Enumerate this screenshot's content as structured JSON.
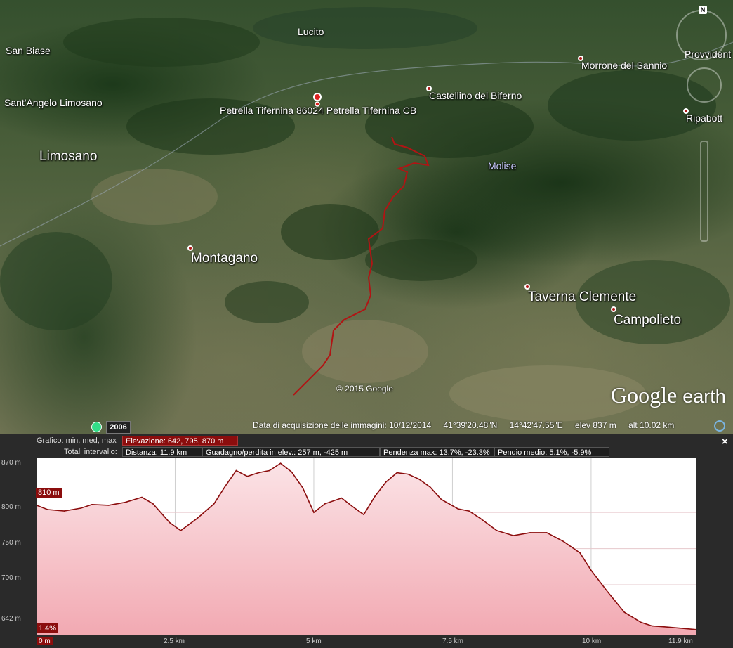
{
  "map": {
    "places": [
      {
        "name": "San Biase",
        "cls": "sm"
      },
      {
        "name": "Lucito",
        "cls": "sm"
      },
      {
        "name": "Sant'Angelo Limosano",
        "cls": "sm"
      },
      {
        "name": "Limosano",
        "cls": "lg"
      },
      {
        "name": "Petrella Tifernina  86024 Petrella Tifernina CB",
        "cls": "sm"
      },
      {
        "name": "Castellino del Biferno",
        "cls": "sm"
      },
      {
        "name": "Morrone del Sannio",
        "cls": "sm"
      },
      {
        "name": "Provvident",
        "cls": "sm"
      },
      {
        "name": "Ripabott",
        "cls": "sm"
      },
      {
        "name": "Molise",
        "cls": "sm region"
      },
      {
        "name": "Montagano",
        "cls": "lg"
      },
      {
        "name": "Taverna Clemente",
        "cls": "lg"
      },
      {
        "name": "Campolieto",
        "cls": "lg"
      }
    ],
    "copyright": "© 2015 Google",
    "logo": {
      "google": "Google",
      "earth": "earth"
    },
    "year": "2006",
    "status": {
      "acquisition": "Data di acquisizione delle immagini: 10/12/2014",
      "lat": "41°39'20.48\"N",
      "lon": "14°42'47.55\"E",
      "elev": "elev   837 m",
      "alt": "alt  10.02 km"
    },
    "compass_label": "N"
  },
  "profile": {
    "graph_label": "Grafico: min, med, max",
    "elevation": "Elevazione: 642, 795, 870 m",
    "totals_label": "Totali intervallo:",
    "distance": "Distanza: 11.9 km",
    "gain": "Guadagno/perdita in elev.: 257 m, -425 m",
    "slope_max": "Pendenza max: 13.7%, -23.3%",
    "slope_avg": "Pendio medio: 5.1%, -5.9%",
    "close": "×",
    "marker_elev": "810 m",
    "marker_slope": "1.4%"
  },
  "chart_data": {
    "type": "area",
    "title": "",
    "xlabel": "",
    "ylabel": "",
    "xlim": [
      0,
      11.9
    ],
    "ylim": [
      630,
      875
    ],
    "y_ticks": [
      "870 m",
      "800 m",
      "750 m",
      "700 m",
      "642 m"
    ],
    "x_ticks": [
      "0 m",
      "2.5 km",
      "5 km",
      "7.5 km",
      "10 km",
      "11.9 km"
    ],
    "color": "#8b0d0d",
    "fill_top": "#fbe3e6",
    "fill_bottom": "#f2a9b2",
    "x": [
      0,
      0.2,
      0.5,
      0.8,
      1.0,
      1.3,
      1.6,
      1.9,
      2.1,
      2.4,
      2.6,
      2.9,
      3.2,
      3.4,
      3.6,
      3.8,
      4.0,
      4.2,
      4.4,
      4.6,
      4.8,
      5.0,
      5.2,
      5.5,
      5.7,
      5.9,
      6.1,
      6.3,
      6.5,
      6.7,
      6.9,
      7.1,
      7.3,
      7.6,
      7.8,
      8.0,
      8.3,
      8.6,
      8.9,
      9.2,
      9.5,
      9.8,
      10.0,
      10.3,
      10.6,
      10.9,
      11.1,
      11.3,
      11.6,
      11.9
    ],
    "y": [
      810,
      804,
      802,
      806,
      811,
      810,
      814,
      821,
      812,
      786,
      775,
      792,
      812,
      836,
      858,
      850,
      855,
      858,
      868,
      856,
      834,
      800,
      812,
      820,
      808,
      797,
      822,
      842,
      855,
      853,
      846,
      835,
      818,
      805,
      802,
      792,
      775,
      768,
      772,
      772,
      760,
      744,
      720,
      690,
      662,
      648,
      643,
      642,
      640,
      638
    ]
  }
}
